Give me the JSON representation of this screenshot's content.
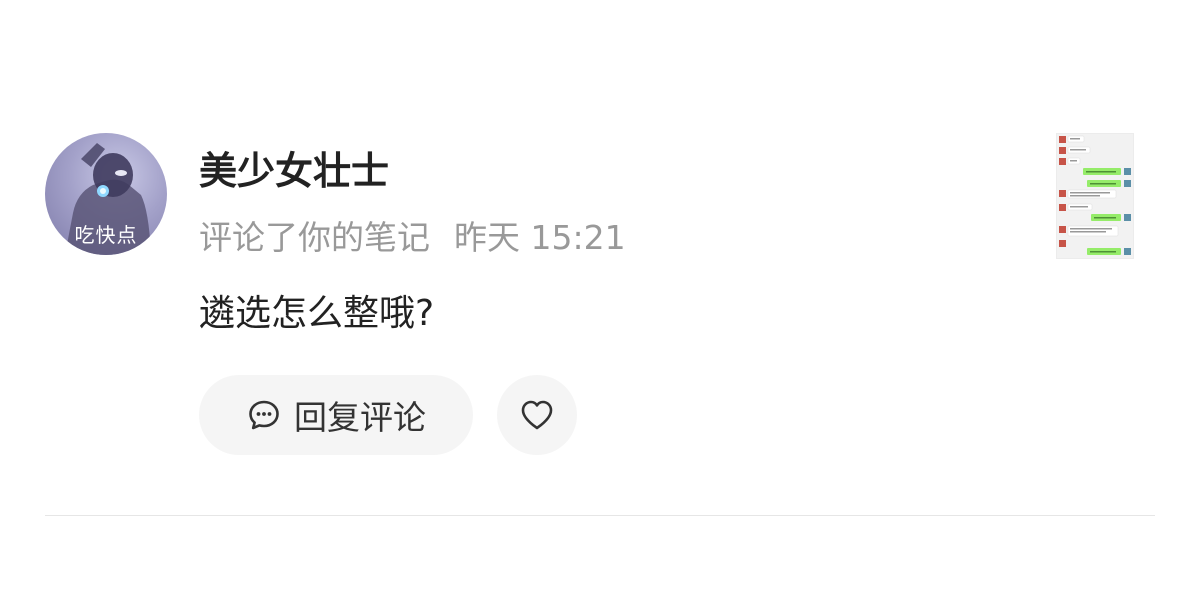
{
  "notification": {
    "avatar": {
      "caption": "吃快点"
    },
    "user": {
      "name": "美少女壮士"
    },
    "action": "评论了你的笔记",
    "time": "昨天 15:21",
    "comment": "遴选怎么整哦?",
    "buttons": {
      "reply_label": "回复评论",
      "reply_icon": "comment-bubble-icon",
      "like_icon": "heart-icon"
    },
    "note_thumbnail": {
      "description_icon": "chat-screenshot-thumbnail"
    }
  },
  "colors": {
    "username": "#222222",
    "meta": "#999999",
    "button_bg": "#f5f5f5",
    "divider": "#e6e6e6",
    "chat_bubble_green": "#95ec69"
  }
}
